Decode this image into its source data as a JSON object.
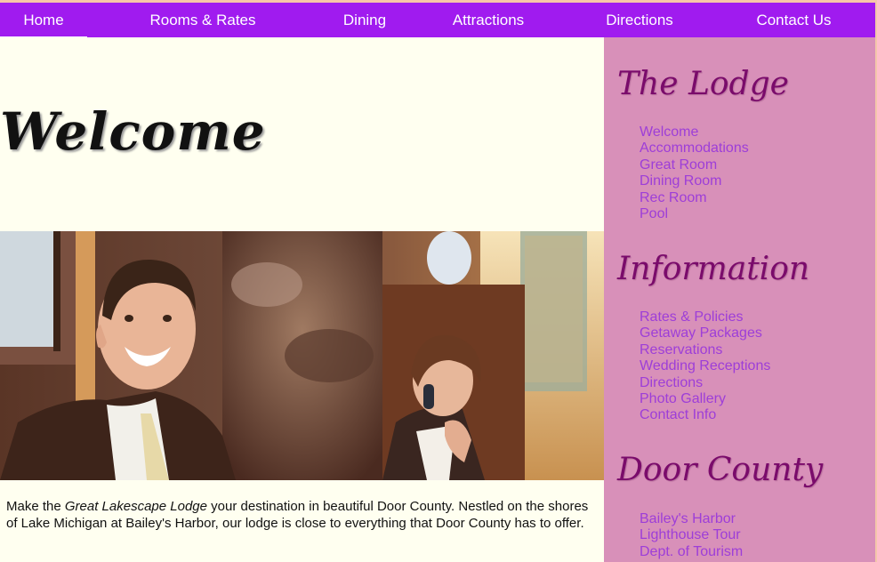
{
  "nav": {
    "items": [
      {
        "label": "Home"
      },
      {
        "label": "Rooms & Rates"
      },
      {
        "label": "Dining"
      },
      {
        "label": "Attractions"
      },
      {
        "label": "Directions"
      },
      {
        "label": "Contact Us"
      }
    ],
    "active": "Home"
  },
  "main": {
    "heading": "Welcome",
    "photo_icon": "hotel-reception-photo",
    "intro_before": "Make the ",
    "intro_emphasis": "Great Lakescape Lodge",
    "intro_after": " your destination in beautiful Door County. Nestled on the shores of Lake Michigan at Bailey's Harbor, our lodge is close to everything that Door County has to offer."
  },
  "sidebar": {
    "sections": [
      {
        "title": "The Lodge",
        "links": [
          "Welcome",
          "Accommodations",
          "Great Room",
          "Dining Room",
          "Rec Room",
          "Pool"
        ]
      },
      {
        "title": "Information",
        "links": [
          "Rates & Policies",
          "Getaway Packages",
          "Reservations",
          "Wedding Receptions",
          "Directions",
          "Photo Gallery",
          "Contact Info"
        ]
      },
      {
        "title": "Door County",
        "links": [
          "Bailey's Harbor",
          "Lighthouse Tour",
          "Dept. of Tourism"
        ]
      }
    ]
  },
  "colors": {
    "nav_bg": "#a01bef",
    "page_bg": "#fffff0",
    "sidebar_bg": "#d890b9",
    "sidebar_heading": "#7a0b6b",
    "sidebar_link": "#9d3ed8"
  }
}
